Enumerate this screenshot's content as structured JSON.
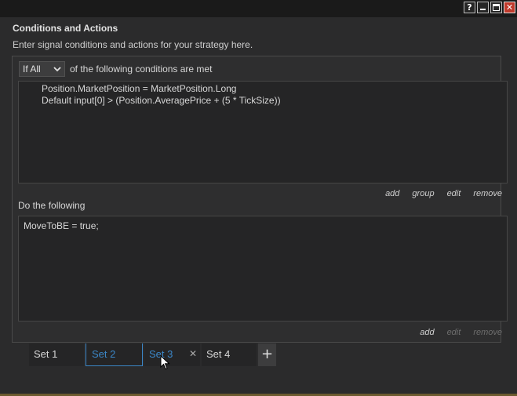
{
  "window": {
    "buttons": {
      "help_label": "?",
      "close_label": "✕"
    }
  },
  "section": {
    "title": "Conditions and Actions",
    "description": "Enter signal conditions and actions for your strategy here."
  },
  "conditions": {
    "match_mode": "If All",
    "match_suffix": "of the following conditions are met",
    "lines": [
      "Position.MarketPosition = MarketPosition.Long",
      "Default input[0] > (Position.AveragePrice + (5 * TickSize))"
    ],
    "links": {
      "add": "add",
      "group": "group",
      "edit": "edit",
      "remove": "remove"
    }
  },
  "actions": {
    "label": "Do the following",
    "lines": [
      "MoveToBE = true;"
    ],
    "links": {
      "add": "add",
      "edit": "edit",
      "remove": "remove"
    }
  },
  "tabs": [
    {
      "label": "Set 1",
      "state": "normal"
    },
    {
      "label": "Set 2",
      "state": "selected"
    },
    {
      "label": "Set 3",
      "state": "hover"
    },
    {
      "label": "Set 4",
      "state": "normal"
    }
  ],
  "tab_close_label": "✕",
  "add_tab_label": "+",
  "colors": {
    "background": "#2b2b2c",
    "accent_blue": "#3b86c6",
    "close_red": "#c0392b"
  }
}
